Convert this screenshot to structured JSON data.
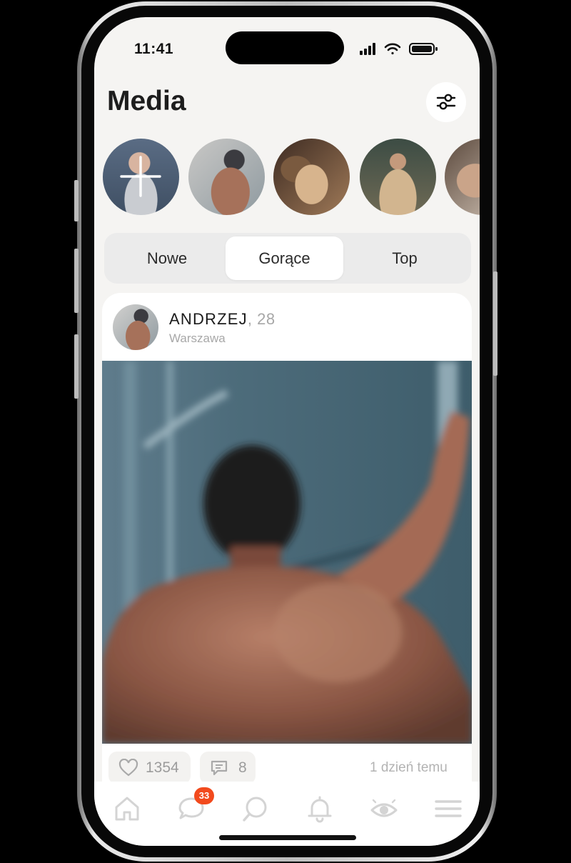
{
  "status_bar": {
    "time": "11:41"
  },
  "header": {
    "title": "Media"
  },
  "icons": {
    "filter": "sliders-icon",
    "add_story": "plus-icon",
    "like": "heart-icon",
    "comment": "chat-icon",
    "nav": [
      "home-icon",
      "messages-icon",
      "search-icon",
      "bell-icon",
      "eye-icon",
      "menu-icon"
    ]
  },
  "stories": [
    {
      "type": "add"
    },
    {
      "type": "user"
    },
    {
      "type": "user"
    },
    {
      "type": "user"
    },
    {
      "type": "user"
    }
  ],
  "tabs": [
    {
      "label": "Nowe",
      "active": false
    },
    {
      "label": "Gorące",
      "active": true
    },
    {
      "label": "Top",
      "active": false
    }
  ],
  "post": {
    "user": {
      "name": "ANDRZEJ",
      "age": ", 28",
      "city": "Warszawa"
    },
    "likes": "1354",
    "comments": "8",
    "time_ago": "1 dzień temu"
  },
  "nav": {
    "messages_badge": "33"
  },
  "colors": {
    "accent": "#f24a1d",
    "background": "#f5f4f2",
    "card": "#ffffff"
  }
}
